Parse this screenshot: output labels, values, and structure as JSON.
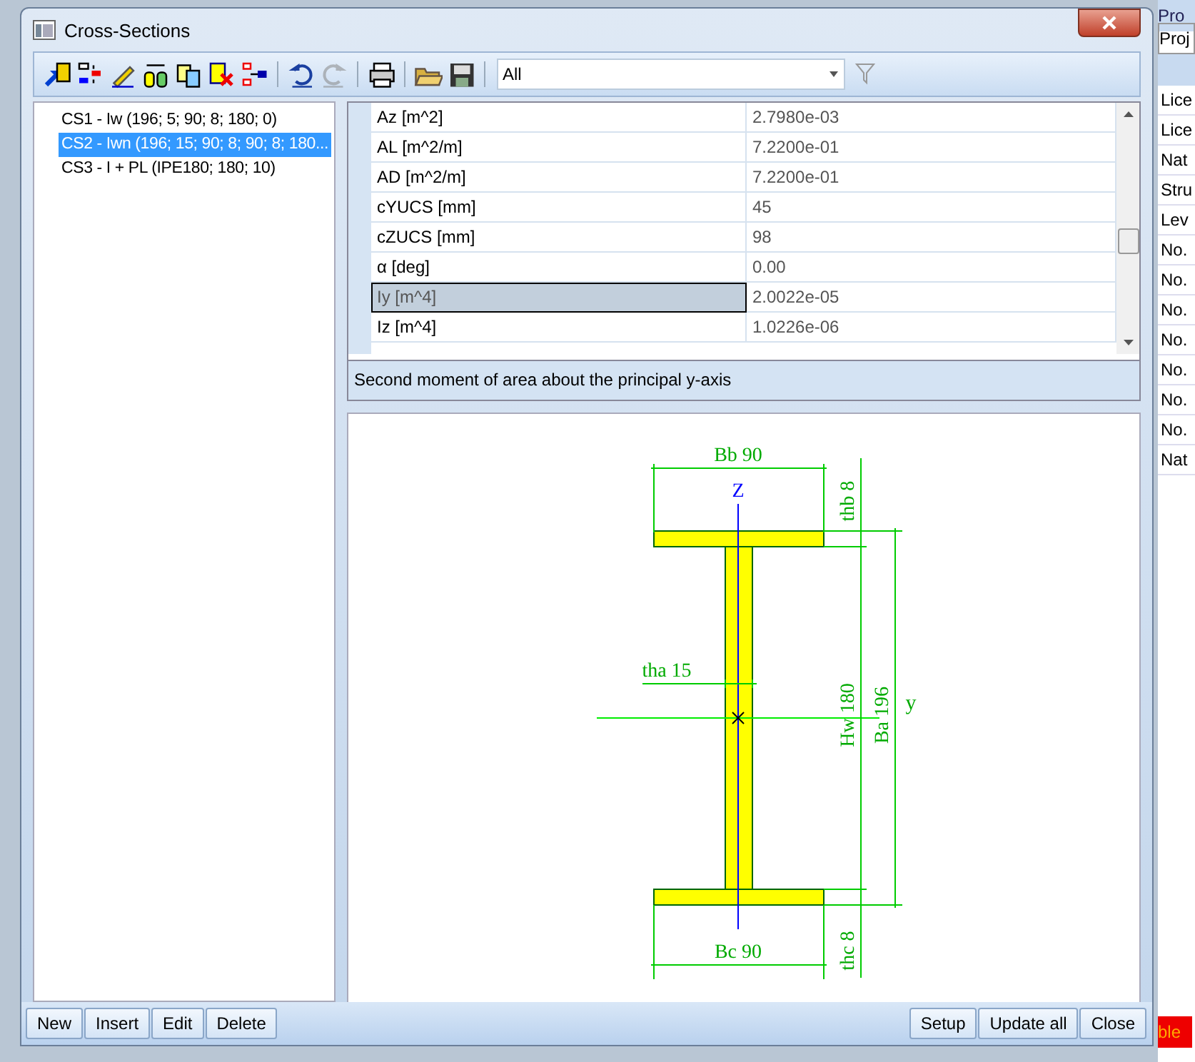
{
  "window": {
    "title": "Cross-Sections"
  },
  "toolbar": {
    "buttons": [
      {
        "kind": "new-item",
        "disabled": false
      },
      {
        "kind": "insert",
        "disabled": false
      },
      {
        "kind": "edit",
        "disabled": false
      },
      {
        "kind": "measure",
        "disabled": false
      },
      {
        "kind": "copy",
        "disabled": false
      },
      {
        "kind": "delete",
        "disabled": false
      },
      {
        "kind": "split",
        "disabled": false
      },
      {
        "kind": "undo",
        "disabled": false
      },
      {
        "kind": "redo",
        "disabled": true
      },
      {
        "kind": "print",
        "disabled": false
      },
      {
        "kind": "open",
        "disabled": false
      },
      {
        "kind": "save",
        "disabled": false
      }
    ],
    "filter": {
      "value": "All"
    }
  },
  "tree": {
    "items": [
      {
        "label": "CS1 - Iw (196; 5; 90; 8; 180; 0)",
        "selected": false
      },
      {
        "label": "CS2 - Iwn (196; 15; 90; 8; 90; 8; 180...",
        "selected": true
      },
      {
        "label": "CS3 - I + PL (IPE180; 180; 10)",
        "selected": false
      }
    ]
  },
  "properties": {
    "rows": [
      {
        "name": "Az [m^2]",
        "value": "2.7980e-03",
        "selected": false
      },
      {
        "name": "AL [m^2/m]",
        "value": "7.2200e-01",
        "selected": false
      },
      {
        "name": "AD [m^2/m]",
        "value": "7.2200e-01",
        "selected": false
      },
      {
        "name": "cYUCS [mm]",
        "value": "45",
        "selected": false
      },
      {
        "name": "cZUCS [mm]",
        "value": "98",
        "selected": false
      },
      {
        "name": "α [deg]",
        "value": "0.00",
        "selected": false
      },
      {
        "name": "Iy [m^4]",
        "value": "2.0022e-05",
        "selected": true
      },
      {
        "name": "Iz [m^4]",
        "value": "1.0226e-06",
        "selected": false
      }
    ],
    "description": "Second moment of area about the principal y-axis"
  },
  "drawing": {
    "labels": {
      "bb": "Bb 90",
      "z": "Z",
      "thb": "thb 8",
      "tha": "tha 15",
      "hw": "Hw 180",
      "ba": "Ba 196",
      "y": "y",
      "bc": "Bc 90",
      "thc": "thc 8"
    }
  },
  "buttons_left": [
    "New",
    "Insert",
    "Edit",
    "Delete"
  ],
  "buttons_right": [
    "Setup",
    "Update all",
    "Close"
  ],
  "side_panel": {
    "title": "Pro",
    "field": "Proj",
    "items": [
      "Lice",
      "Lice",
      "Nat",
      "Stru",
      "Lev",
      "No.",
      "No.",
      "No.",
      "No.",
      "No.",
      "No.",
      "No.",
      "Nat"
    ]
  },
  "background_label": "ble"
}
